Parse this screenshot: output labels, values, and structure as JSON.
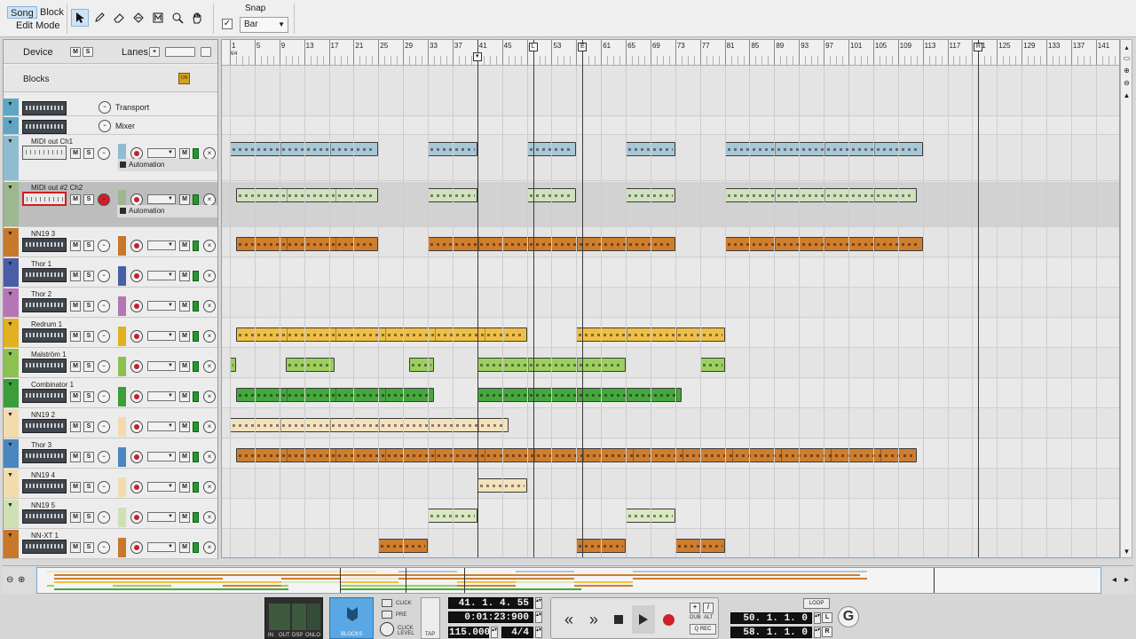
{
  "toolbar": {
    "mode_song": "Song",
    "mode_block": "Block",
    "edit_mode": "Edit Mode",
    "snap_label": "Snap",
    "snap_value": "Bar",
    "snap_checked": "✓"
  },
  "tracklist": {
    "device_label": "Device",
    "lanes_label": "Lanes",
    "mute": "M",
    "solo": "S",
    "add": "+",
    "blocks_label": "Blocks",
    "blocks_on": "ON",
    "automation_label": "Automation",
    "tracks": [
      {
        "name": "Transport",
        "color": "#5ea6c4",
        "type": "transport"
      },
      {
        "name": "Mixer",
        "color": "#5ea6c4",
        "type": "mixer"
      },
      {
        "name": "MIDI out Ch1",
        "color": "#8fbcd1",
        "type": "midi"
      },
      {
        "name": "MIDI out #2 Ch2",
        "color": "#9cb890",
        "type": "midi2"
      },
      {
        "name": "NN19 3",
        "color": "#c8782a",
        "type": "inst"
      },
      {
        "name": "Thor 1",
        "color": "#4a5ea8",
        "type": "inst"
      },
      {
        "name": "Thor 2",
        "color": "#b675b4",
        "type": "inst"
      },
      {
        "name": "Redrum 1",
        "color": "#e2b120",
        "type": "inst"
      },
      {
        "name": "Malström 1",
        "color": "#8cc050",
        "type": "inst"
      },
      {
        "name": "Combinator 1",
        "color": "#3a9e3a",
        "type": "inst"
      },
      {
        "name": "NN19 2",
        "color": "#f2dcae",
        "type": "inst"
      },
      {
        "name": "Thor 3",
        "color": "#4c86bf",
        "type": "inst"
      },
      {
        "name": "NN19 4",
        "color": "#f2dcae",
        "type": "inst"
      },
      {
        "name": "NN19 5",
        "color": "#cfe0b4",
        "type": "inst"
      },
      {
        "name": "NN-XT 1",
        "color": "#c8782a",
        "type": "inst"
      }
    ]
  },
  "ruler": {
    "bars": [
      "1",
      "5",
      "9",
      "13",
      "17",
      "21",
      "25",
      "29",
      "33",
      "37",
      "41",
      "45",
      "49",
      "53",
      "57",
      "61",
      "65",
      "69",
      "73",
      "77",
      "81",
      "85",
      "89",
      "93",
      "97",
      "101",
      "105",
      "109",
      "113",
      "117",
      "121",
      "125",
      "129",
      "133",
      "137",
      "141"
    ],
    "meter": "4/4"
  },
  "arrange": {
    "markers": [
      "L",
      "E",
      "R"
    ],
    "clips": [
      {
        "lane": 2,
        "bars": [
          [
            1,
            25
          ],
          [
            33,
            41
          ],
          [
            49,
            57
          ],
          [
            65,
            73
          ],
          [
            81,
            113
          ]
        ],
        "color": "#a9c8d6"
      },
      {
        "lane": 3,
        "bars": [
          [
            2,
            25
          ],
          [
            33,
            41
          ],
          [
            49,
            57
          ],
          [
            65,
            73
          ],
          [
            81,
            112
          ]
        ],
        "color": "#cfe2bd"
      },
      {
        "lane": 4,
        "bars": [
          [
            2,
            25
          ],
          [
            33,
            73
          ],
          [
            81,
            113
          ]
        ],
        "color": "#cf7e2e"
      },
      {
        "lane": 7,
        "bars": [
          [
            2,
            49
          ],
          [
            57,
            81
          ]
        ],
        "color": "#efbf45"
      },
      {
        "lane": 8,
        "bars": [
          [
            1,
            2
          ],
          [
            10,
            18
          ],
          [
            30,
            34
          ],
          [
            41,
            65
          ],
          [
            77,
            81
          ]
        ],
        "color": "#9bcf5e"
      },
      {
        "lane": 9,
        "bars": [
          [
            2,
            34
          ],
          [
            41,
            74
          ]
        ],
        "color": "#45a83c"
      },
      {
        "lane": 10,
        "bars": [
          [
            1,
            46
          ]
        ],
        "color": "#f4e2bd"
      },
      {
        "lane": 11,
        "bars": [
          [
            2,
            112
          ]
        ],
        "color": "#cf7e2e"
      },
      {
        "lane": 12,
        "bars": [
          [
            41,
            49
          ]
        ],
        "color": "#f4e2bd"
      },
      {
        "lane": 13,
        "bars": [
          [
            33,
            41
          ],
          [
            65,
            73
          ]
        ],
        "color": "#d8e8c0"
      },
      {
        "lane": 14,
        "bars": [
          [
            25,
            33
          ],
          [
            57,
            65
          ],
          [
            73,
            81
          ]
        ],
        "color": "#cf7e2e"
      }
    ]
  },
  "transport": {
    "labels": {
      "in": "IN",
      "out": "OUT",
      "dsp": "DSP",
      "onlo": "ONLO",
      "blocks": "BLOCKS",
      "click": "CLICK",
      "pre": "PRE",
      "click_level": "CLICK LEVEL",
      "tap": "TAP",
      "dub": "DUB",
      "alt": "ALT",
      "q_rec": "Q REC",
      "loop": "LOOP",
      "l": "L",
      "r": "R"
    },
    "position": "41.  1.  4.  55",
    "time": "0:01:23:900",
    "tempo": "115.000",
    "signature": "4/4",
    "loop_left": "50.  1.  1.     0",
    "loop_right": "58.  1.  1.     0"
  }
}
